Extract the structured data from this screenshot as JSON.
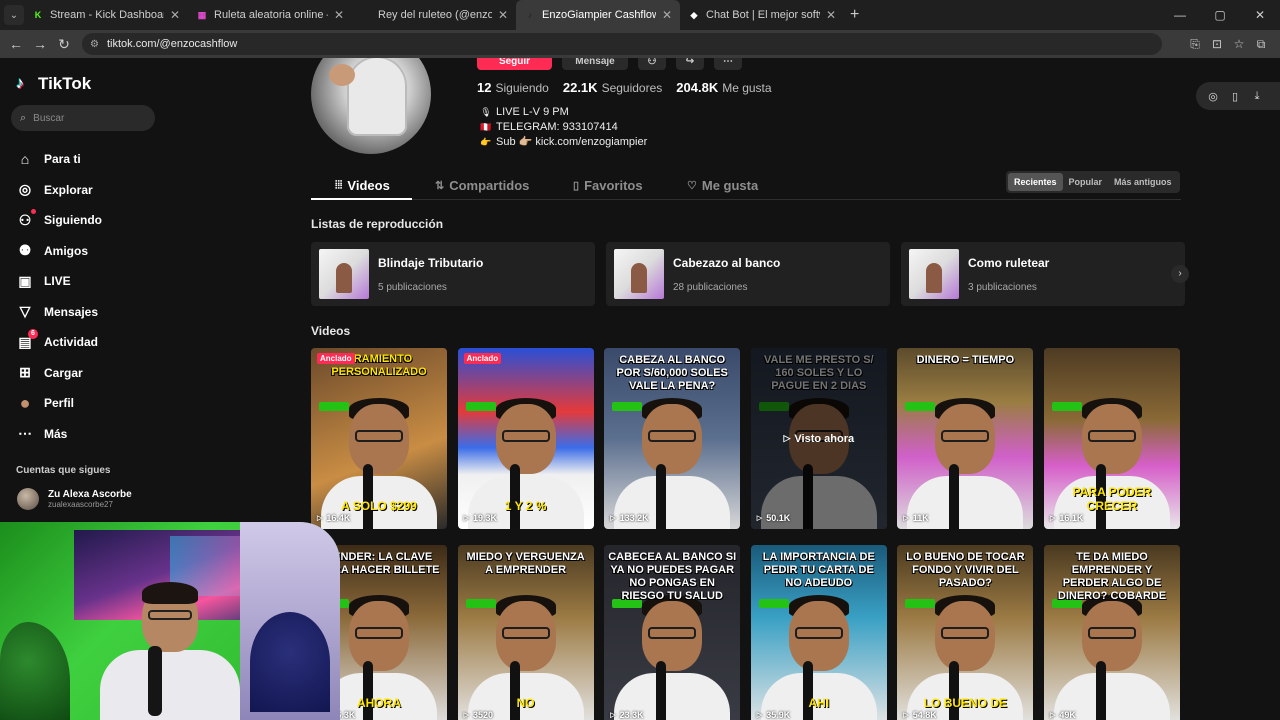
{
  "browser": {
    "tabs": [
      {
        "title": "Stream - Kick Dashboard",
        "fav": "K",
        "favcolor": "#53fc18",
        "active": false
      },
      {
        "title": "Ruleta aleatoria online – ruleta",
        "fav": "▦",
        "favcolor": "#e04bd0",
        "active": false
      },
      {
        "title": "Rey del ruleteo (@enzoeasycash",
        "fav": "♪",
        "favcolor": "#222222",
        "active": false
      },
      {
        "title": "EnzoGiampier Cashflow (@enzo",
        "fav": "♪",
        "favcolor": "#222222",
        "active": true
      },
      {
        "title": "Chat Bot | El mejor software pa",
        "fav": "◆",
        "favcolor": "#ffffff",
        "active": false
      }
    ],
    "url": "tiktok.com/@enzocashflow"
  },
  "tiktok": {
    "brand": "TikTok",
    "search_placeholder": "Buscar",
    "menu": [
      {
        "label": "Para ti",
        "icon": "home-icon",
        "glyph": "⌂"
      },
      {
        "label": "Explorar",
        "icon": "compass-icon",
        "glyph": "◎"
      },
      {
        "label": "Siguiendo",
        "icon": "following-icon",
        "glyph": "⚇"
      },
      {
        "label": "Amigos",
        "icon": "friends-icon",
        "glyph": "⚉"
      },
      {
        "label": "LIVE",
        "icon": "live-icon",
        "glyph": "▣"
      },
      {
        "label": "Mensajes",
        "icon": "messages-icon",
        "glyph": "▽"
      },
      {
        "label": "Actividad",
        "icon": "activity-icon",
        "glyph": "▤",
        "badge": "6"
      },
      {
        "label": "Cargar",
        "icon": "upload-icon",
        "glyph": "⊞"
      },
      {
        "label": "Perfil",
        "icon": "profile-avatar-icon",
        "glyph": "●"
      },
      {
        "label": "Más",
        "icon": "more-icon",
        "glyph": "⋯"
      }
    ],
    "following_title": "Cuentas que sigues",
    "following": {
      "name": "Zu Alexa Ascorbe",
      "handle": "zualexaascorbe27"
    }
  },
  "profile": {
    "buttons": {
      "follow": "Seguir",
      "message": "Mensaje"
    },
    "stats": [
      {
        "value": "12",
        "label": "Siguiendo"
      },
      {
        "value": "22.1K",
        "label": "Seguidores"
      },
      {
        "value": "204.8K",
        "label": "Me gusta"
      }
    ],
    "bio": [
      {
        "emoji": "🎙",
        "text": "LIVE L-V 9 PM"
      },
      {
        "emoji": "🇵🇪",
        "text": "TELEGRAM: 933107414"
      },
      {
        "emoji": "👉",
        "text": "Sub 👉🏼 kick.com/enzogiampier"
      }
    ],
    "tabs": [
      {
        "label": "Videos",
        "glyph": "⦙⦙⦙",
        "icon": "grid-icon"
      },
      {
        "label": "Compartidos",
        "glyph": "⇅",
        "icon": "repost-icon"
      },
      {
        "label": "Favoritos",
        "glyph": "▯",
        "icon": "bookmark-icon"
      },
      {
        "label": "Me gusta",
        "glyph": "♡",
        "icon": "liked-icon"
      }
    ],
    "sort": [
      "Recientes",
      "Popular",
      "Más antiguos"
    ],
    "playlists_title": "Listas de reproducción",
    "playlists": [
      {
        "name": "Blindaje Tributario",
        "count": "5 publicaciones"
      },
      {
        "name": "Cabezazo al banco",
        "count": "28 publicaciones"
      },
      {
        "name": "Como ruletear",
        "count": "3 publicaciones"
      }
    ],
    "videos_title": "Videos",
    "videos": [
      {
        "caption": "DRAMIENTO PERSONALIZADO",
        "bottom": "A SOLO $299",
        "views": "16.4K",
        "pinned": "Anclado",
        "bg": "linear-gradient(160deg,#6c4a2b,#c98d44 60%,#2a2a2a)"
      },
      {
        "caption": "",
        "bottom": "1 Y 2 %",
        "views": "19.3K",
        "pinned": "Anclado",
        "bg": "linear-gradient(180deg,#2a4fd6 0%,#e43a3a 35%,#3b6ce8 55%,#f0f0f0 70%,#ffffff 100%)"
      },
      {
        "caption": "CABEZA AL BANCO POR S/60,000 SOLES VALE LA PENA?",
        "bottom": "",
        "views": "133.2K",
        "pinned": "",
        "bg": "linear-gradient(180deg,#3a4a6a,#5b6f8f 50%,#d7d7d7)"
      },
      {
        "caption": "VALE ME PRESTO S/ 160 SOLES Y LO PAGUE EN 2 DIAS",
        "bottom": "",
        "views": "50.1K",
        "pinned": "",
        "watched": "Visto ahora",
        "bg": "linear-gradient(180deg,#2c3546,#4b5567)"
      },
      {
        "caption": "DINERO = TIEMPO",
        "bottom": "",
        "views": "11K",
        "pinned": "",
        "bg": "linear-gradient(180deg,#5c4b2c,#9a7d42 30%,#d060c9 60%,#dcdcdc)"
      },
      {
        "caption": "",
        "bottom": "PARA PODER CRECER",
        "views": "16.1K",
        "pinned": "",
        "bg": "linear-gradient(180deg,#4e3b23,#8a6a36 40%,#d65fc9 65%,#e8e8e8)"
      },
      {
        "caption": "VENDER: LA CLAVE PARA HACER BILLETE",
        "bottom": "AHORA",
        "views": "146.3K",
        "pinned": "",
        "bg": "linear-gradient(180deg,#3d2b17,#8b6a3a 40%,#e2e2e2)"
      },
      {
        "caption": "MIEDO Y VERGUENZA A EMPRENDER",
        "bottom": "NO",
        "views": "3520",
        "pinned": "",
        "bg": "linear-gradient(180deg,#4b3a21,#9c7b44 40%,#e6e6e6)"
      },
      {
        "caption": "cabecea al banco si ya no puedes pagar no pongas en riesgo tu salud",
        "bottom": "",
        "views": "23.3K",
        "pinned": "",
        "bg": "linear-gradient(180deg,#25262c,#3a3c45)"
      },
      {
        "caption": "LA IMPORTANCIA DE PEDIR TU CARTA DE NO ADEUDO",
        "bottom": "AHI",
        "views": "35.9K",
        "pinned": "",
        "bg": "linear-gradient(180deg,#1a5a7a,#39a0c4 40%,#e6e6e6)"
      },
      {
        "caption": "LO BUENO DE TOCAR FONDO Y VIVIR DEL PASADO?",
        "bottom": "LO BUENO DE",
        "views": "54.8K",
        "pinned": "",
        "bg": "linear-gradient(180deg,#4b3a21,#9b7a43 40%,#e6e6e6)"
      },
      {
        "caption": "TE DA MIEDO EMPRENDER Y PERDER ALGO DE DINERO? COBARDE",
        "bottom": "",
        "views": "49K",
        "pinned": "",
        "bg": "linear-gradient(180deg,#4a3920,#9b7a43 40%,#e6e6e6)"
      }
    ]
  }
}
